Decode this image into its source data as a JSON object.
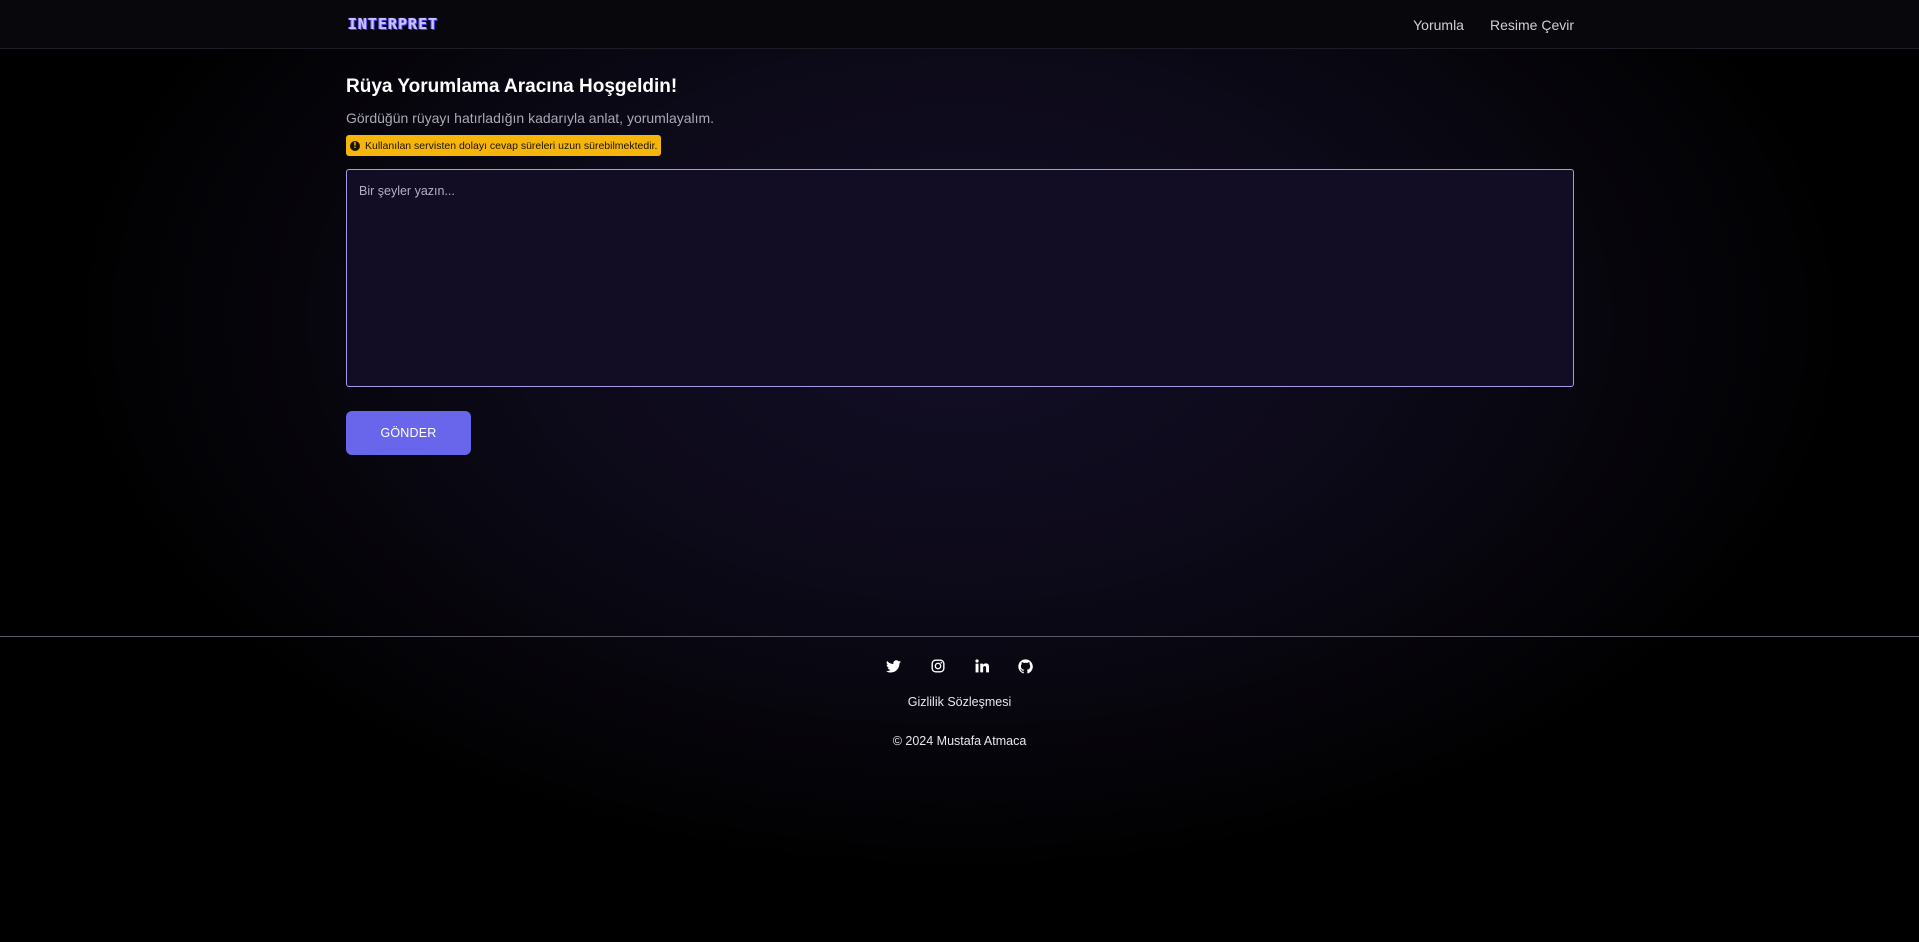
{
  "header": {
    "logo_text": "INTERPRET",
    "nav": [
      {
        "label": "Yorumla"
      },
      {
        "label": "Resime Çevir"
      }
    ]
  },
  "main": {
    "title": "Rüya Yorumlama Aracına Hoşgeldin!",
    "subtitle": "Gördüğün rüyayı hatırladığın kadarıyla anlat, yorumlayalım.",
    "warning": "Kullanılan servisten dolayı cevap süreleri uzun sürebilmektedir.",
    "input_placeholder": "Bir şeyler yazın...",
    "input_value": "",
    "submit_label": "GÖNDER"
  },
  "footer": {
    "social_icons": [
      "twitter-icon",
      "instagram-icon",
      "linkedin-icon",
      "github-icon"
    ],
    "privacy_label": "Gizlilik Sözleşmesi",
    "copyright": "© 2024  Mustafa Atmaca"
  },
  "colors": {
    "background": "#000000",
    "accent": "#6a66ec",
    "input_border": "#a99ae6",
    "warning_bg": "#f5b50a"
  }
}
